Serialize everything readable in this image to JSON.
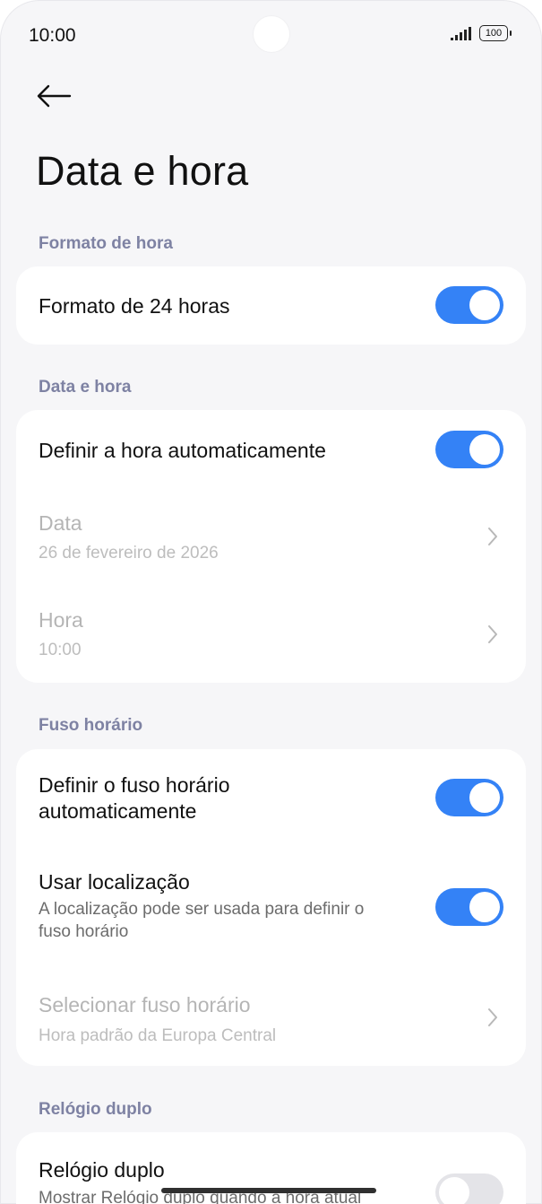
{
  "status": {
    "time": "10:00",
    "battery": "100",
    "signal": "signal-icon"
  },
  "header": {
    "title": "Data e hora",
    "back": "back-arrow-icon"
  },
  "sections": {
    "format": {
      "label": "Formato de hora",
      "h24": {
        "title": "Formato de 24 horas",
        "on": true
      }
    },
    "datetime": {
      "label": "Data e hora",
      "auto": {
        "title": "Definir a hora automaticamente",
        "on": true
      },
      "date": {
        "title": "Data",
        "value": "26 de fevereiro de 2026"
      },
      "time": {
        "title": "Hora",
        "value": "10:00"
      }
    },
    "timezone": {
      "label": "Fuso horário",
      "auto_line1": "Definir o fuso horário",
      "auto_line2": "automaticamente",
      "auto_on": true,
      "location": {
        "title": "Usar localização",
        "desc_line1": "A localização pode ser usada para definir o",
        "desc_line2": "fuso horário",
        "on": true
      },
      "select": {
        "title": "Selecionar fuso horário",
        "value": "Hora padrão da Europa Central"
      }
    },
    "dual": {
      "label": "Relógio duplo",
      "title": "Relógio duplo",
      "desc": "Mostrar Relógio duplo quando a hora atual",
      "on": false
    }
  },
  "colors": {
    "accent": "#3482f6",
    "section_label": "#7e82a3",
    "background": "#f6f6f8"
  }
}
